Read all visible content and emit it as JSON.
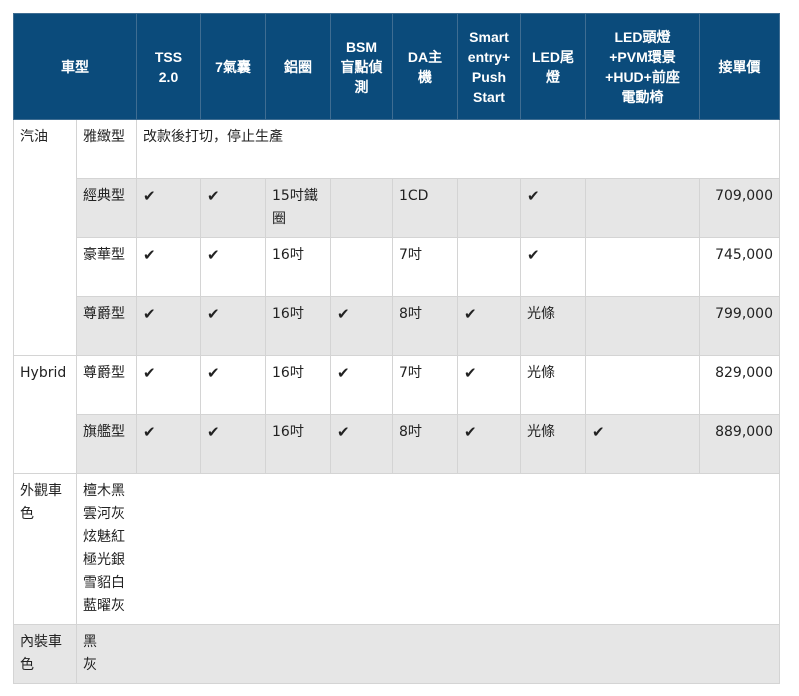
{
  "headers": [
    "車型",
    "TSS 2.0",
    "7氣囊",
    "鋁圈",
    "BSM盲點偵測",
    "DA主機",
    "Smart entry+ Push Start",
    "LED尾燈",
    "LED頭燈 +PVM環景 +HUD+前座電動椅",
    "接單價"
  ],
  "check": "✔",
  "groups": {
    "gas": "汽油",
    "hybrid": "Hybrid",
    "exterior": "外觀車色",
    "interior": "內裝車色"
  },
  "rows": [
    {
      "trim": "雅緻型",
      "note": "改款後打切，停止生產"
    },
    {
      "trim": "經典型",
      "wheel": "15吋鐵圈",
      "da": "1CD",
      "price": "709,000"
    },
    {
      "trim": "豪華型",
      "wheel": "16吋",
      "da": "7吋",
      "price": "745,000"
    },
    {
      "trim": "尊爵型",
      "wheel": "16吋",
      "da": "8吋",
      "tail": "光條",
      "price": "799,000"
    },
    {
      "trim": "尊爵型",
      "wheel": "16吋",
      "da": "7吋",
      "tail": "光條",
      "price": "829,000"
    },
    {
      "trim": "旗艦型",
      "wheel": "16吋",
      "da": "8吋",
      "tail": "光條",
      "price": "889,000"
    }
  ],
  "exterior_colors": [
    "檀木黑",
    "雲河灰",
    "炫魅紅",
    "極光銀",
    "雪貂白",
    "藍曜灰"
  ],
  "interior_colors": [
    "黑",
    "灰"
  ]
}
